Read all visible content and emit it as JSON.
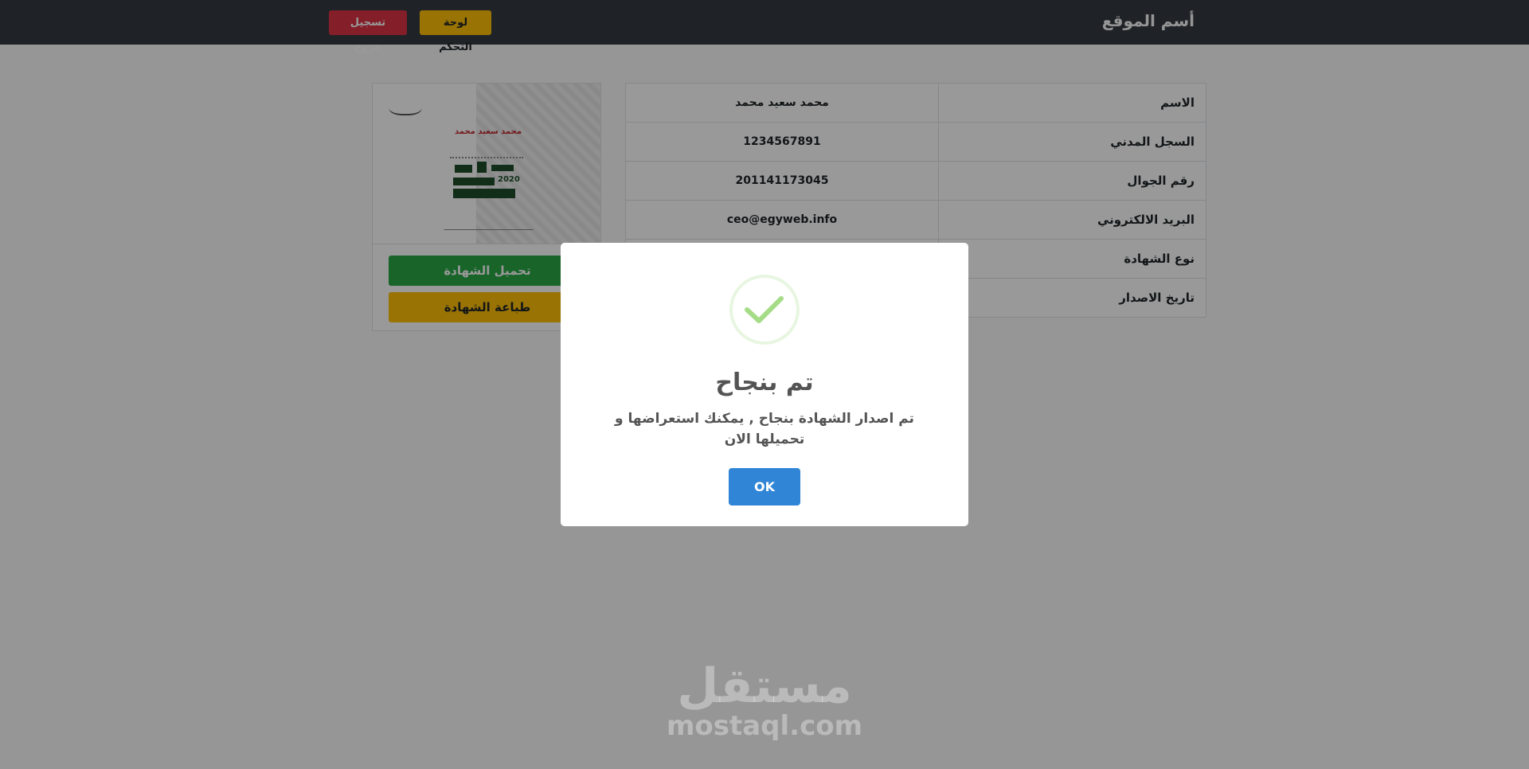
{
  "navbar": {
    "brand": "أسم الموقع",
    "dashboard_label": "لوحة التحكم",
    "logout_label": "تسجيل خروج"
  },
  "info": {
    "rows": [
      {
        "label": "الاسم",
        "value": "محمد سعيد محمد"
      },
      {
        "label": "السجل المدني",
        "value": "1234567891"
      },
      {
        "label": "رقم الجوال",
        "value": "201141173045"
      },
      {
        "label": "البريد الالكتروني",
        "value": "ceo@egyweb.info"
      },
      {
        "label": "نوع الشهادة",
        "value": ""
      },
      {
        "label": "تاريخ الاصدار",
        "value": ""
      }
    ]
  },
  "certificate": {
    "name": "محمد سعيد محمد",
    "year": "2020",
    "download_label": "تحميل الشهادة",
    "print_label": "طباعة الشهادة"
  },
  "modal": {
    "title": "تم بنجاح",
    "text": "تم اصدار الشهادة بنجاح , يمكنك استعراضها و تحميلها الان",
    "ok_label": "OK"
  },
  "watermark": {
    "arabic": "مستقل",
    "latin": "mostaql.com"
  },
  "colors": {
    "navbar": "#343a40",
    "success": "#28a745",
    "warning": "#ffc107",
    "danger": "#dc3545",
    "primary": "#3085d6",
    "check": "#a5dc86"
  }
}
